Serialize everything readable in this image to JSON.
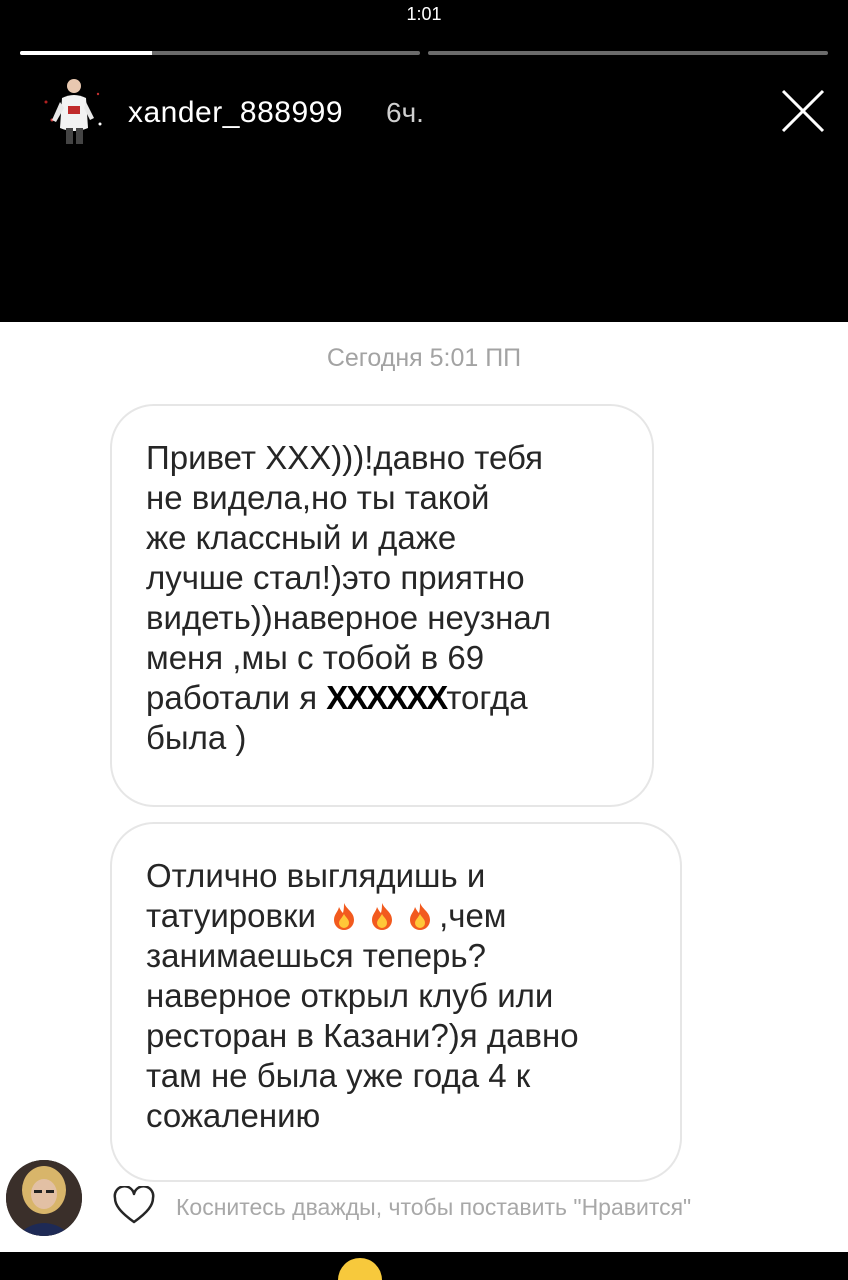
{
  "status_bar": {
    "time": "1:01"
  },
  "story": {
    "progress": [
      1.0,
      0.0
    ],
    "progress_first_fill": 0.33,
    "username": "xander_888999",
    "time_ago": "6ч."
  },
  "chat": {
    "date_label": "Сегодня 5:01 ПП",
    "message1": {
      "lines": [
        "Привет ХХХ)))!давно тебя",
        "не видела,но ты такой",
        "же классный и даже",
        "лучше стал!)это приятно",
        "видеть))наверное неузнал",
        "меня ,мы с тобой в 69"
      ],
      "line7_before": "работали я ",
      "line7_redacted": "ХХХХХХ",
      "line7_after": "тогда",
      "line8": "была )"
    },
    "message2": {
      "line1": "Отлично выглядишь и",
      "line2_before": "татуировки",
      "line2_after": ",чем",
      "lines_rest": [
        "занимаешься теперь?",
        "наверное открыл клуб или",
        "ресторан в Казани?)я давно",
        "там не была уже года 4 к",
        "сожалению"
      ]
    }
  },
  "footer": {
    "like_hint": "Коснитесь дважды, чтобы поставить \"Нравится\""
  },
  "icons": {
    "close": "close-icon",
    "heart": "heart-icon",
    "fire": "fire-emoji-icon"
  },
  "colors": {
    "background": "#000000",
    "panel": "#ffffff",
    "text": "#262626",
    "muted": "#a3a3a3",
    "bubble_border": "#e6e6e6"
  }
}
